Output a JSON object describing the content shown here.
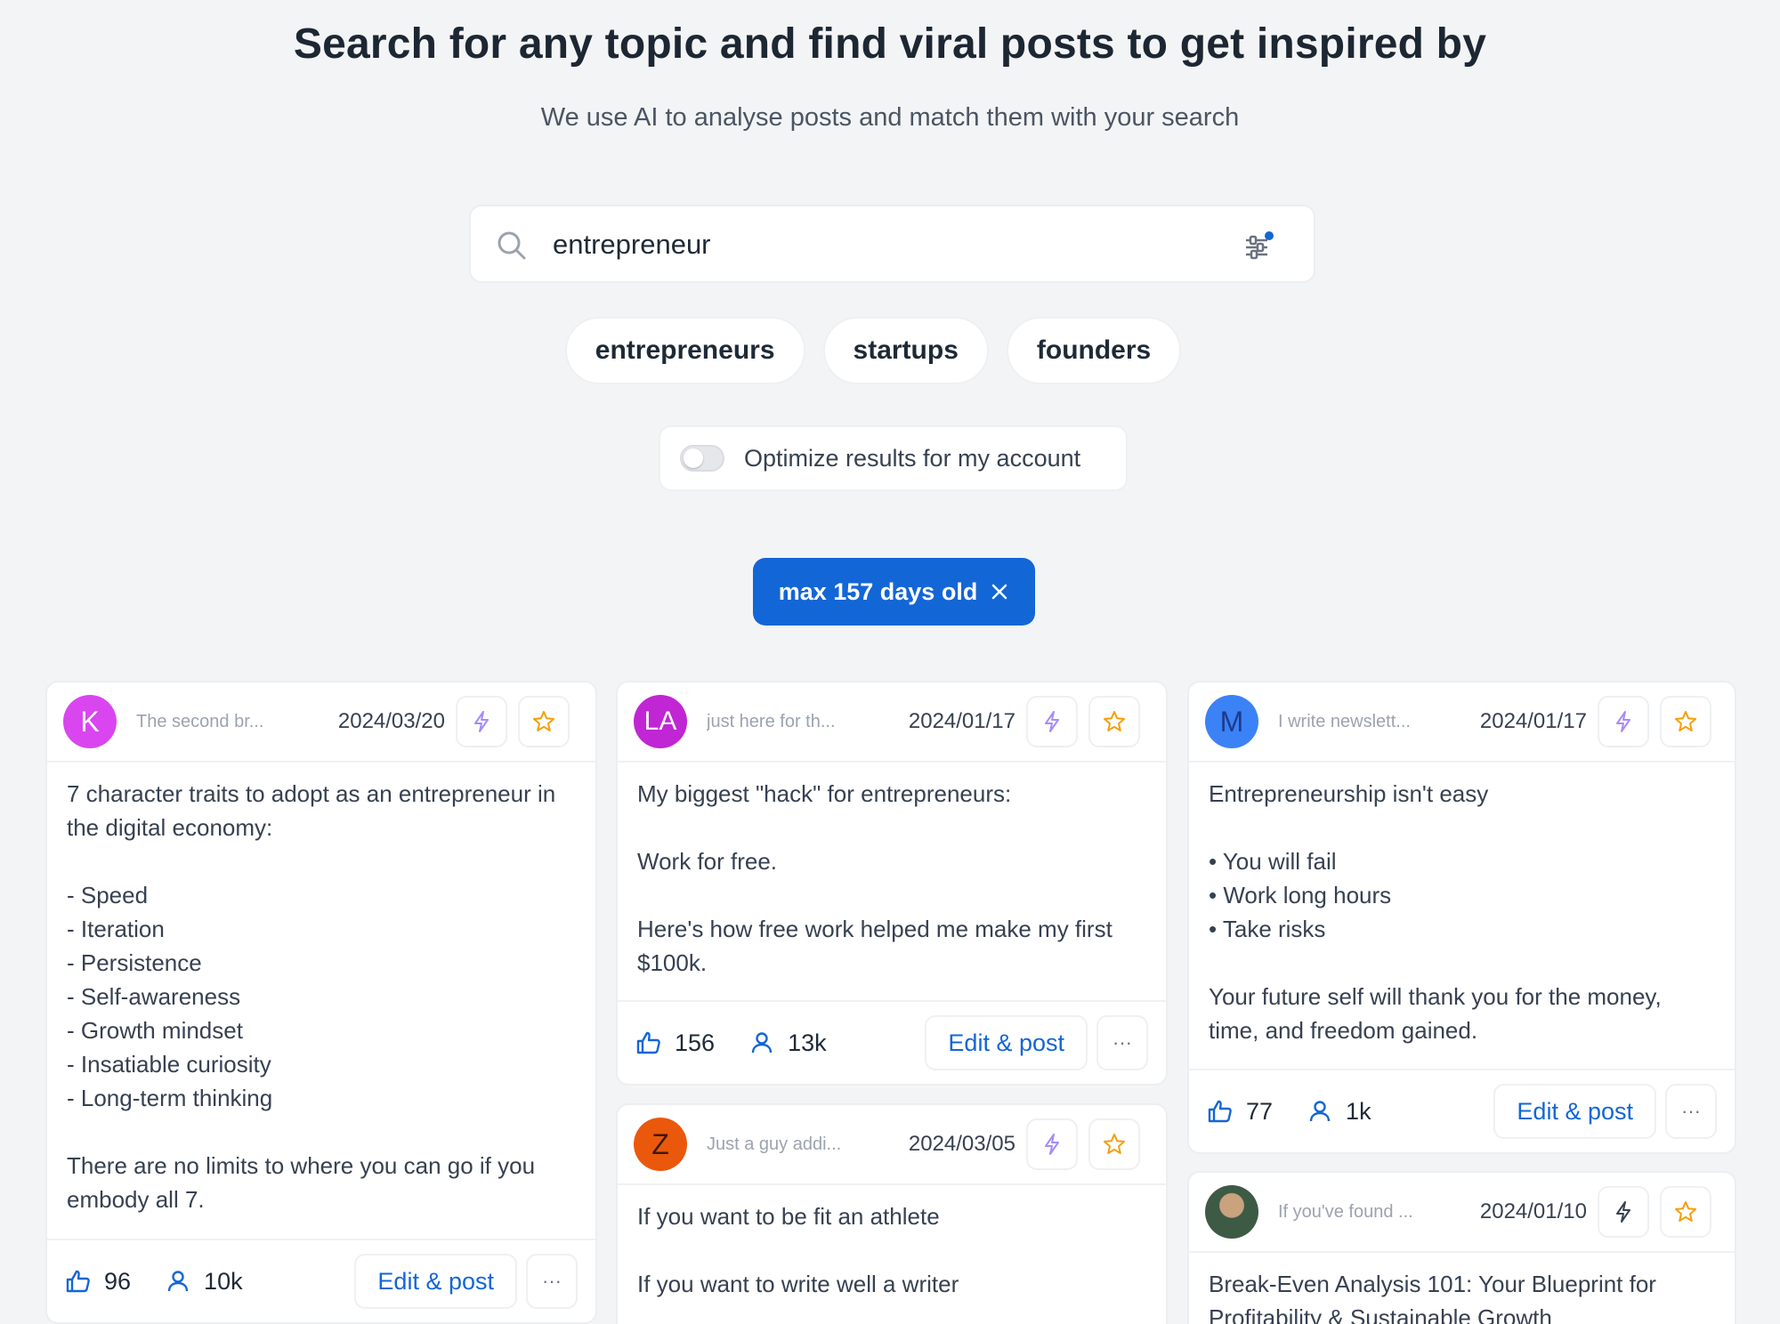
{
  "header": {
    "title": "Search for any topic and find viral posts to get inspired by",
    "subtitle": "We use AI to analyse posts and match them with your search"
  },
  "search": {
    "value": "entrepreneur",
    "placeholder": ""
  },
  "suggestions": [
    "entrepreneurs",
    "startups",
    "founders"
  ],
  "optimize": {
    "label": "Optimize results for my account",
    "enabled": false
  },
  "active_filter": {
    "label": "max 157 days old"
  },
  "colors": {
    "accent": "#1366d6",
    "star": "#f59e0b",
    "bolt": "#a78bfa"
  },
  "cards": [
    {
      "avatar_letter": "K",
      "avatar_color": "#d946ef",
      "headline": "The second br...",
      "date": "2024/03/20",
      "body": "7 character traits to adopt as an entrepreneur in the digital economy:\n\n- Speed\n- Iteration\n- Persistence\n- Self-awareness\n- Growth mindset\n- Insatiable curiosity\n- Long-term thinking\n\nThere are no limits to where you can go if you embody all 7.",
      "likes": "96",
      "followers": "10k",
      "edit_label": "Edit & post",
      "more_label": "···"
    },
    {
      "avatar_letter": "LA",
      "avatar_color": "#c026d3",
      "headline": "just here for th...",
      "date": "2024/01/17",
      "body": "My biggest \"hack\" for entrepreneurs:\n\nWork for free.\n\nHere's how free work helped me make my first $100k.",
      "likes": "156",
      "followers": "13k",
      "edit_label": "Edit & post",
      "more_label": "···"
    },
    {
      "avatar_letter": "M",
      "avatar_color": "#3b82f6",
      "headline": "I write newslett...",
      "date": "2024/01/17",
      "body": "Entrepreneurship isn't easy\n\n• You will fail\n• Work long hours\n• Take risks\n\nYour future self will thank you for the money, time, and freedom gained.",
      "likes": "77",
      "followers": "1k",
      "edit_label": "Edit & post",
      "more_label": "···"
    },
    {
      "avatar_letter": "Z",
      "avatar_color": "#ea580c",
      "headline": "Just a guy addi...",
      "date": "2024/03/05",
      "body": "If you want to be fit  an athlete\n\nIf you want to write well  a writer"
    },
    {
      "avatar_letter": "",
      "avatar_color": "#2f4f3a",
      "headline": "If you've found ...",
      "date": "2024/01/10",
      "body": "Break-Even Analysis 101: Your Blueprint for Profitability & Sustainable Growth"
    }
  ]
}
